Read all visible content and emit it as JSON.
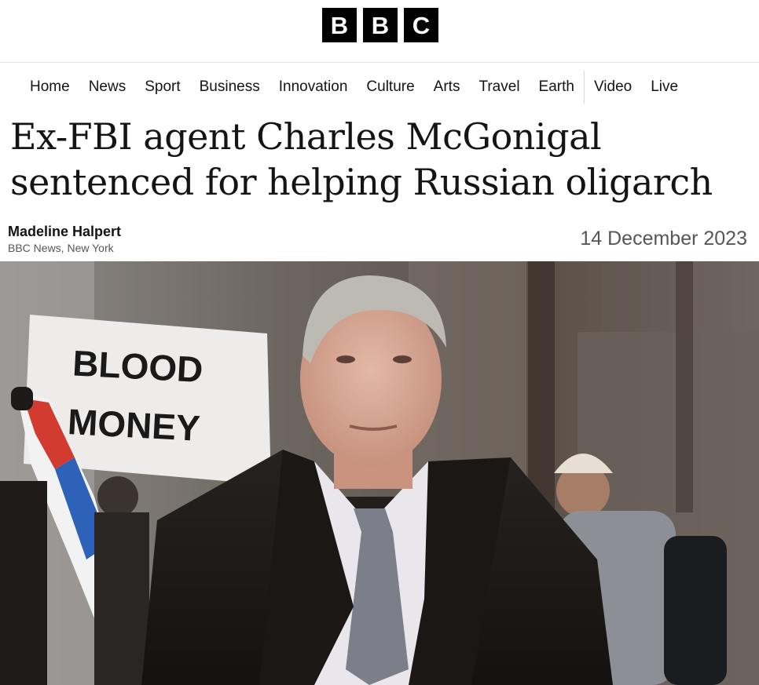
{
  "brand": {
    "letters": [
      "B",
      "B",
      "C"
    ]
  },
  "nav": {
    "items": [
      "Home",
      "News",
      "Sport",
      "Business",
      "Innovation",
      "Culture",
      "Arts",
      "Travel",
      "Earth"
    ],
    "extra": [
      "Video",
      "Live"
    ]
  },
  "article": {
    "headline_line1": "Ex-FBI agent Charles McGonigal",
    "headline_line2": "sentenced for helping Russian oligarch",
    "author": "Madeline Halpert",
    "location": "BBC News, New York",
    "date": "14 December 2023"
  },
  "photo": {
    "sign_line1": "BLOOD",
    "sign_line2": "MONEY"
  }
}
